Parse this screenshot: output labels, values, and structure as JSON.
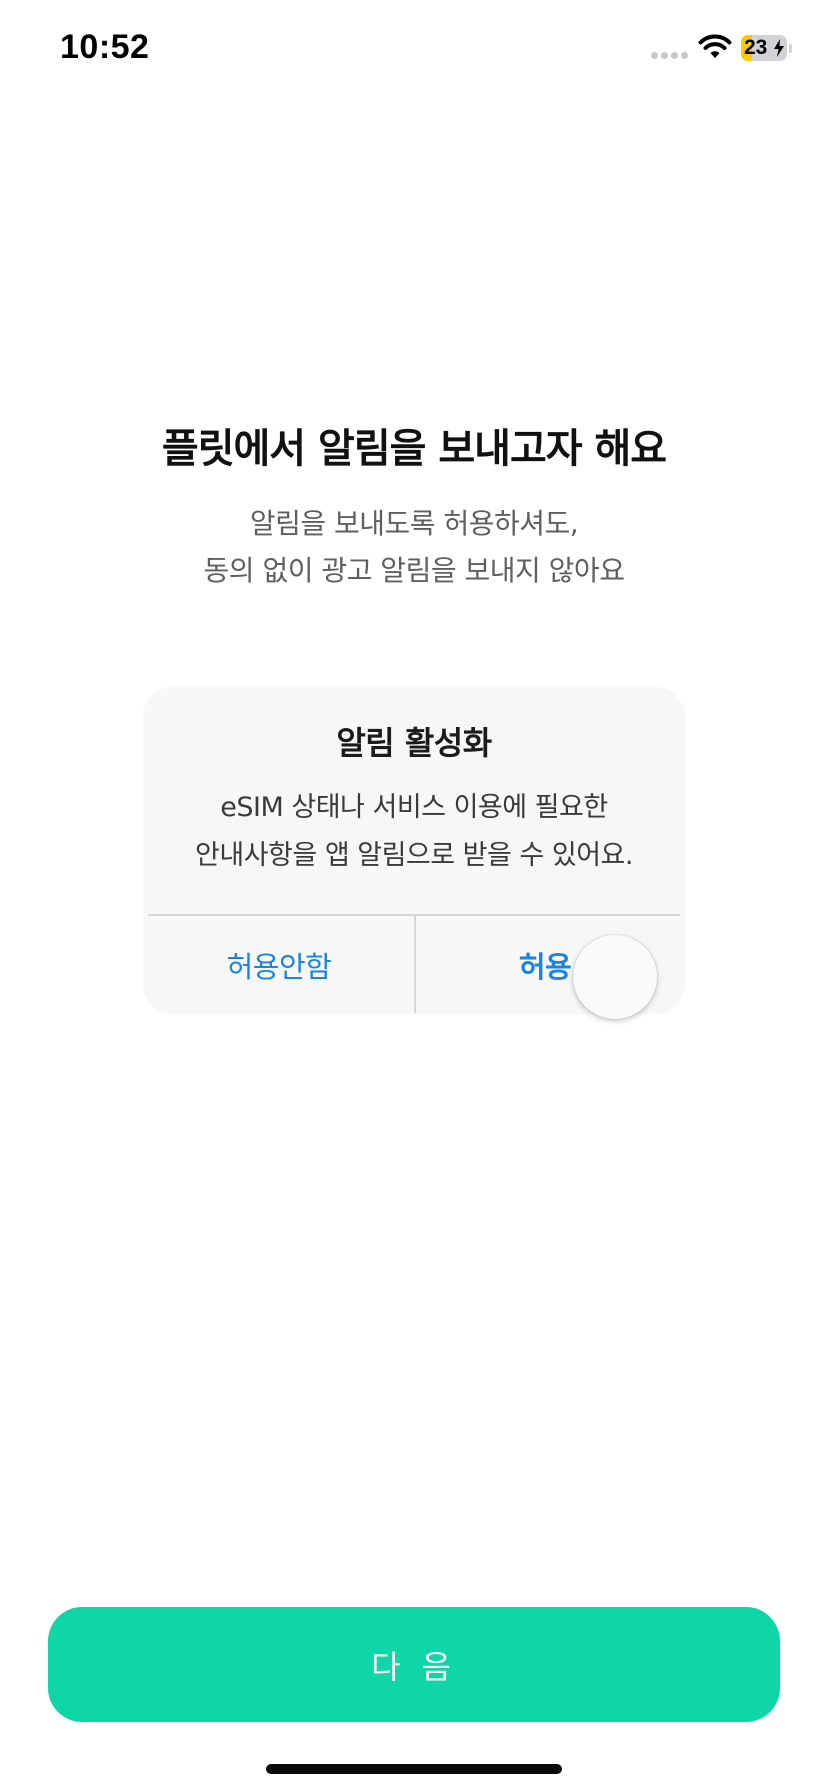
{
  "status_bar": {
    "time": "10:52",
    "battery_level": "23",
    "battery_fraction": 0.23,
    "battery_color": "#ffcc00",
    "charging": true
  },
  "intro": {
    "headline": "플릿에서 알림을 보내고자 해요",
    "subtext_line1": "알림을 보내도록 허용하셔도,",
    "subtext_line2": "동의 없이 광고 알림을 보내지 않아요"
  },
  "alert": {
    "title": "알림 활성화",
    "message_line1": "eSIM 상태나 서비스 이용에 필요한",
    "message_line2": "안내사항을 앱 알림으로 받을 수 있어요.",
    "deny_label": "허용안함",
    "allow_label": "허용",
    "button_color": "#1a84e5"
  },
  "footer": {
    "next_label": "다 음",
    "next_color": "#0fd6a6"
  }
}
